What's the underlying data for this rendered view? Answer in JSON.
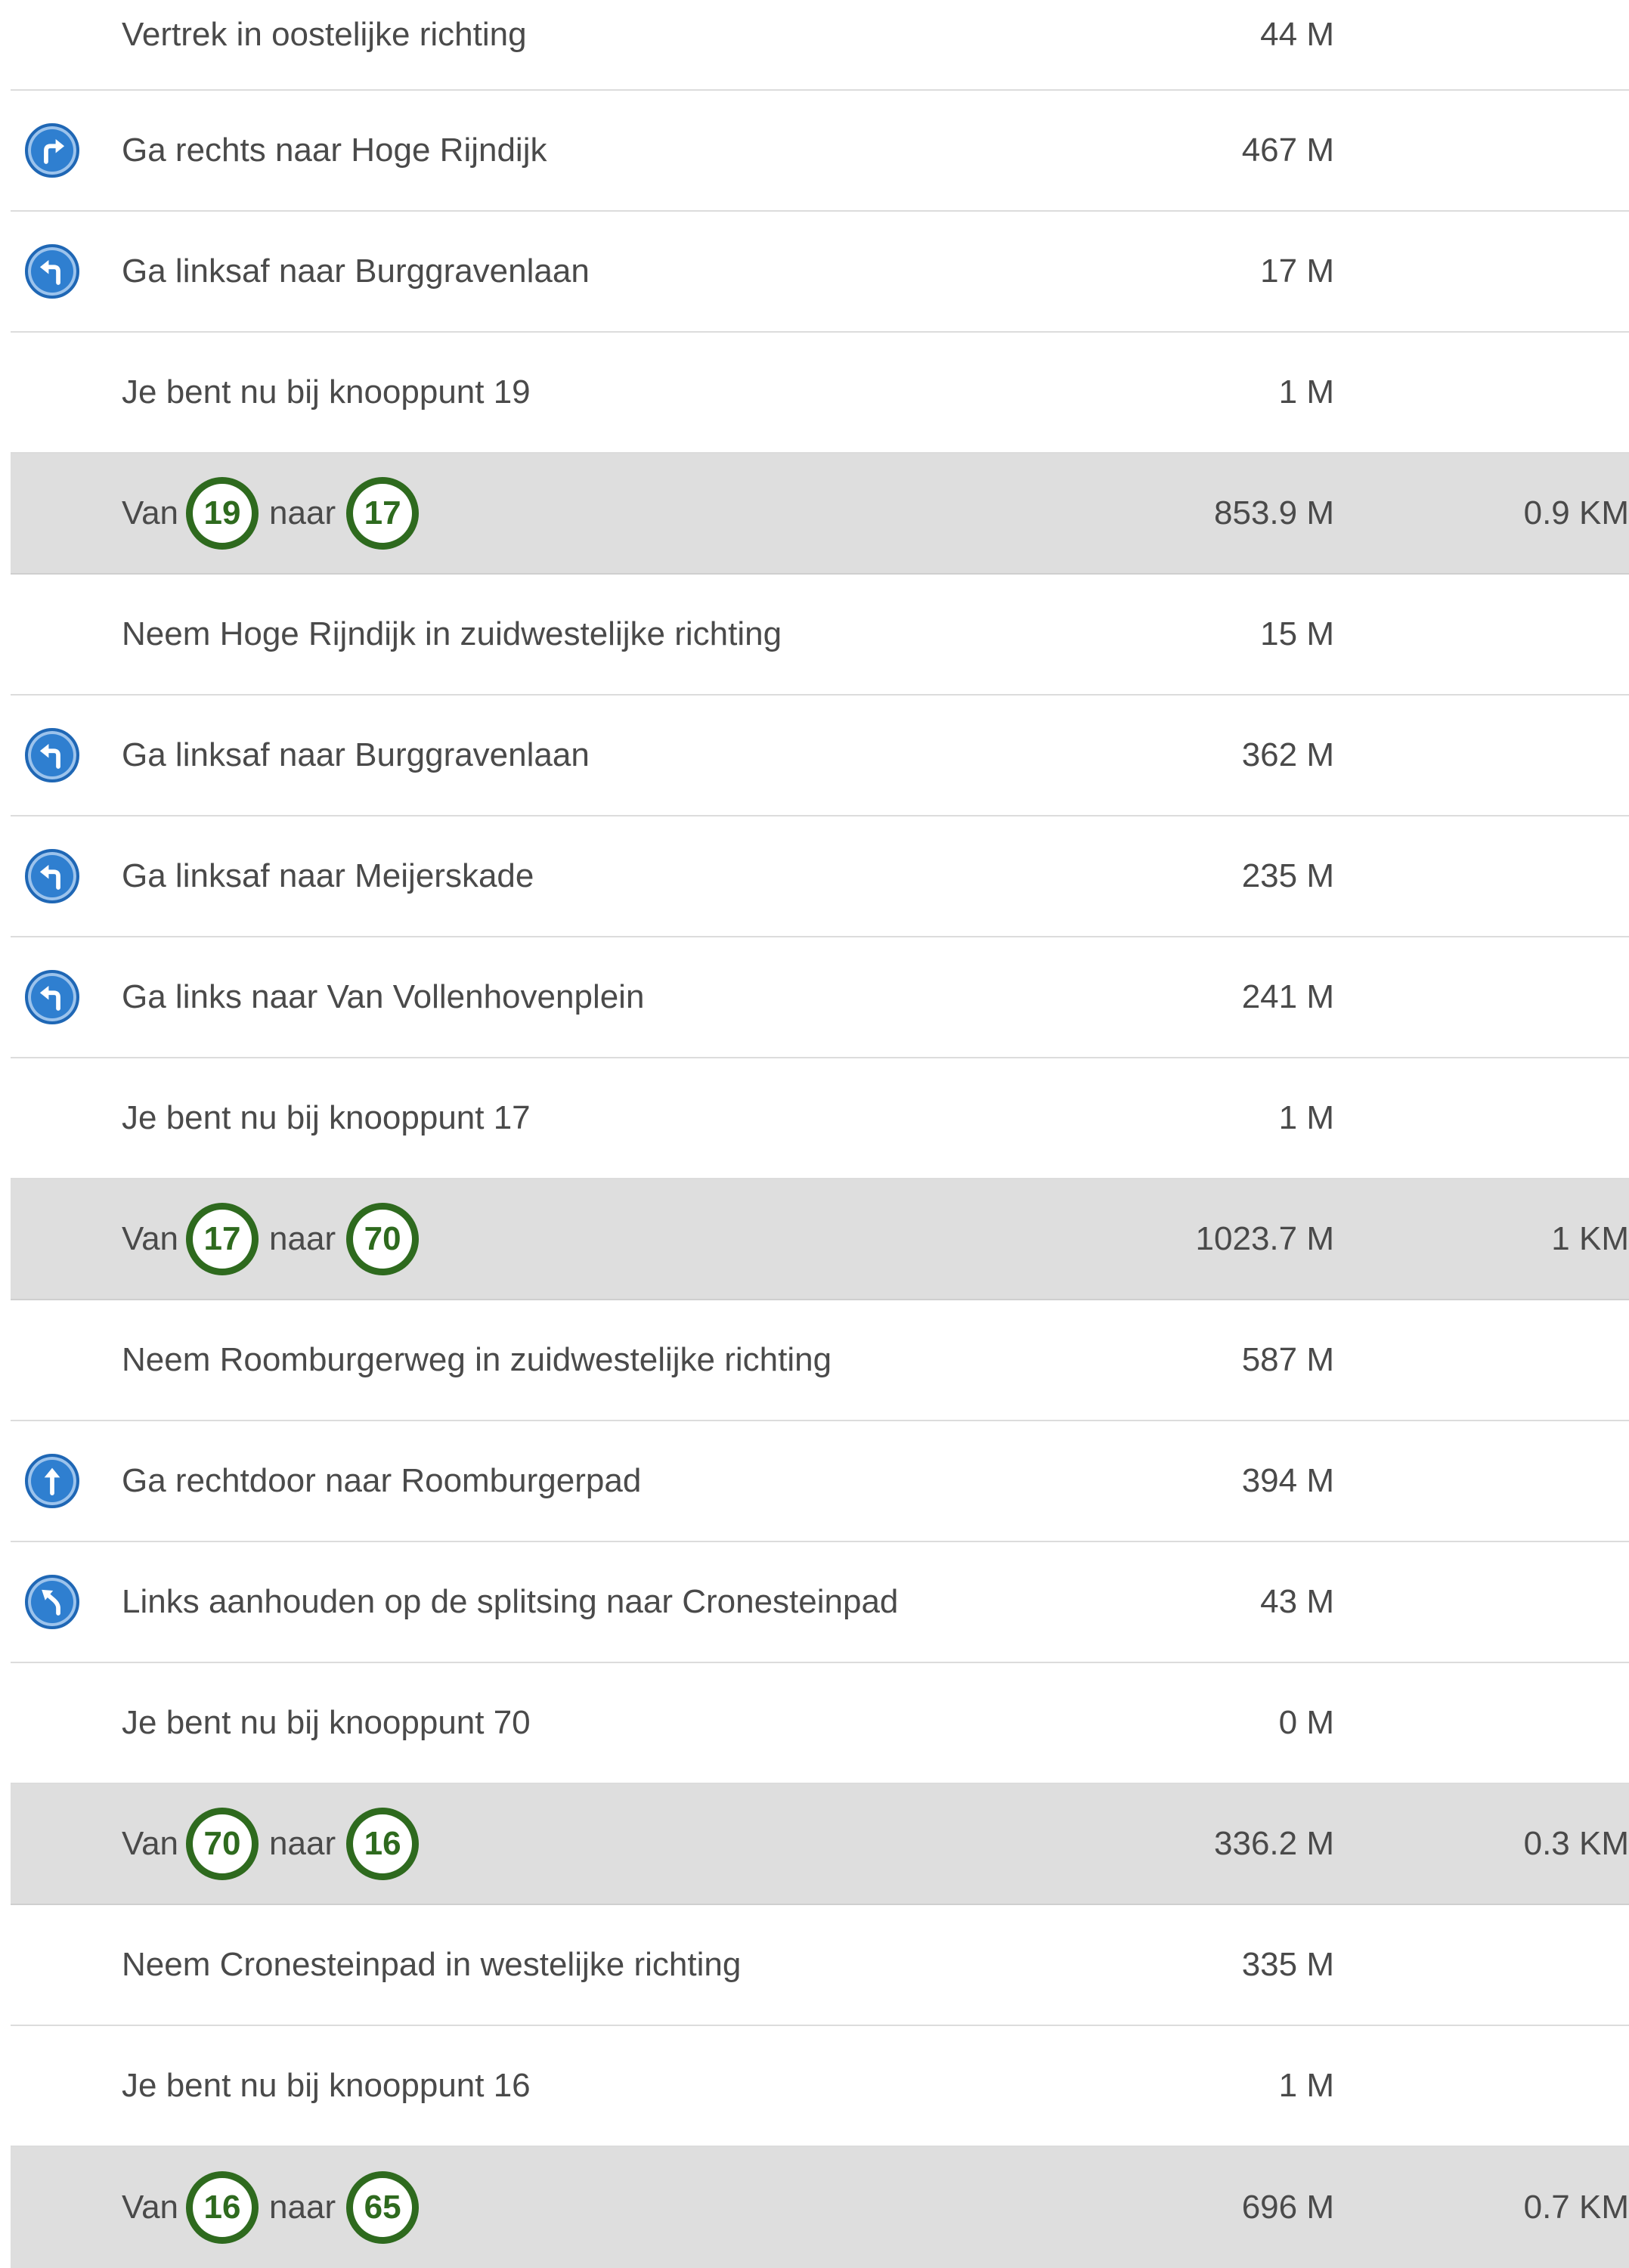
{
  "rows": [
    {
      "type": "step",
      "icon": "",
      "text": "Vertrek in oostelijke richting",
      "distance": "44 M"
    },
    {
      "type": "step",
      "icon": "turn-right-icon",
      "text": "Ga rechts naar Hoge Rijndijk",
      "distance": "467 M"
    },
    {
      "type": "step",
      "icon": "turn-left-icon",
      "text": "Ga linksaf naar Burggravenlaan",
      "distance": "17 M"
    },
    {
      "type": "step",
      "icon": "",
      "text": "Je bent nu bij knooppunt 19",
      "distance": "1 M"
    },
    {
      "type": "leg",
      "van": "Van",
      "from": "19",
      "naar": "naar",
      "to": "17",
      "distance": "853.9 M",
      "total": "0.9 KM"
    },
    {
      "type": "step",
      "icon": "",
      "text": "Neem Hoge Rijndijk in zuidwestelijke richting",
      "distance": "15 M"
    },
    {
      "type": "step",
      "icon": "turn-left-icon",
      "text": "Ga linksaf naar Burggravenlaan",
      "distance": "362 M"
    },
    {
      "type": "step",
      "icon": "turn-left-icon",
      "text": "Ga linksaf naar Meijerskade",
      "distance": "235 M"
    },
    {
      "type": "step",
      "icon": "turn-left-icon",
      "text": "Ga links naar Van Vollenhovenplein",
      "distance": "241 M"
    },
    {
      "type": "step",
      "icon": "",
      "text": "Je bent nu bij knooppunt 17",
      "distance": "1 M"
    },
    {
      "type": "leg",
      "van": "Van",
      "from": "17",
      "naar": "naar",
      "to": "70",
      "distance": "1023.7 M",
      "total": "1 KM"
    },
    {
      "type": "step",
      "icon": "",
      "text": "Neem Roomburgerweg in zuidwestelijke richting",
      "distance": "587 M"
    },
    {
      "type": "step",
      "icon": "straight-icon",
      "text": "Ga rechtdoor naar Roomburgerpad",
      "distance": "394 M"
    },
    {
      "type": "step",
      "icon": "keep-left-icon",
      "text": "Links aanhouden op de splitsing naar Cronesteinpad",
      "distance": "43 M"
    },
    {
      "type": "step",
      "icon": "",
      "text": "Je bent nu bij knooppunt 70",
      "distance": "0 M"
    },
    {
      "type": "leg",
      "van": "Van",
      "from": "70",
      "naar": "naar",
      "to": "16",
      "distance": "336.2 M",
      "total": "0.3 KM"
    },
    {
      "type": "step",
      "icon": "",
      "text": "Neem Cronesteinpad in westelijke richting",
      "distance": "335 M"
    },
    {
      "type": "step",
      "icon": "",
      "text": "Je bent nu bij knooppunt 16",
      "distance": "1 M"
    },
    {
      "type": "leg",
      "van": "Van",
      "from": "16",
      "naar": "naar",
      "to": "65",
      "distance": "696 M",
      "total": "0.7 KM"
    }
  ],
  "colors": {
    "icon_blue": "#2f7fd0",
    "node_green": "#2e6a1e",
    "leg_background": "#dedede"
  }
}
